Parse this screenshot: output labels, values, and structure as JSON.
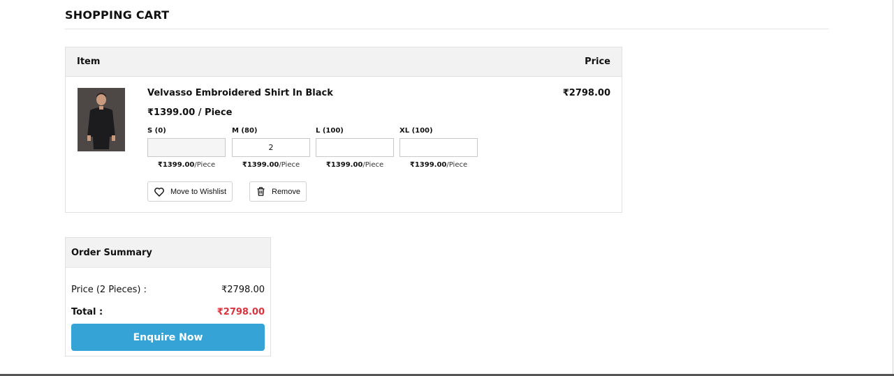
{
  "page": {
    "title": "SHOPPING CART"
  },
  "cart": {
    "headers": {
      "item": "Item",
      "price": "Price"
    },
    "product": {
      "name": "Velvasso Embroidered Shirt In Black",
      "unit_price": "₹1399.00 / Piece",
      "line_total": "₹2798.00",
      "sizes": [
        {
          "label": "S (0)",
          "value": "",
          "price": "₹1399.00",
          "unit": "/Piece"
        },
        {
          "label": "M (80)",
          "value": "2",
          "price": "₹1399.00",
          "unit": "/Piece"
        },
        {
          "label": "L (100)",
          "value": "",
          "price": "₹1399.00",
          "unit": "/Piece"
        },
        {
          "label": "XL (100)",
          "value": "",
          "price": "₹1399.00",
          "unit": "/Piece"
        }
      ],
      "actions": {
        "wishlist": "Move to Wishlist",
        "remove": "Remove"
      }
    }
  },
  "summary": {
    "title": "Order Summary",
    "price_label": "Price (2 Pieces) :",
    "price_value": "₹2798.00",
    "total_label": "Total :",
    "total_value": "₹2798.00",
    "button": "Enquire Now"
  },
  "icons": {
    "wishlist": "heart-icon",
    "remove": "trash-icon"
  },
  "colors": {
    "accent": "#35a3d6",
    "total": "#d9333f"
  }
}
